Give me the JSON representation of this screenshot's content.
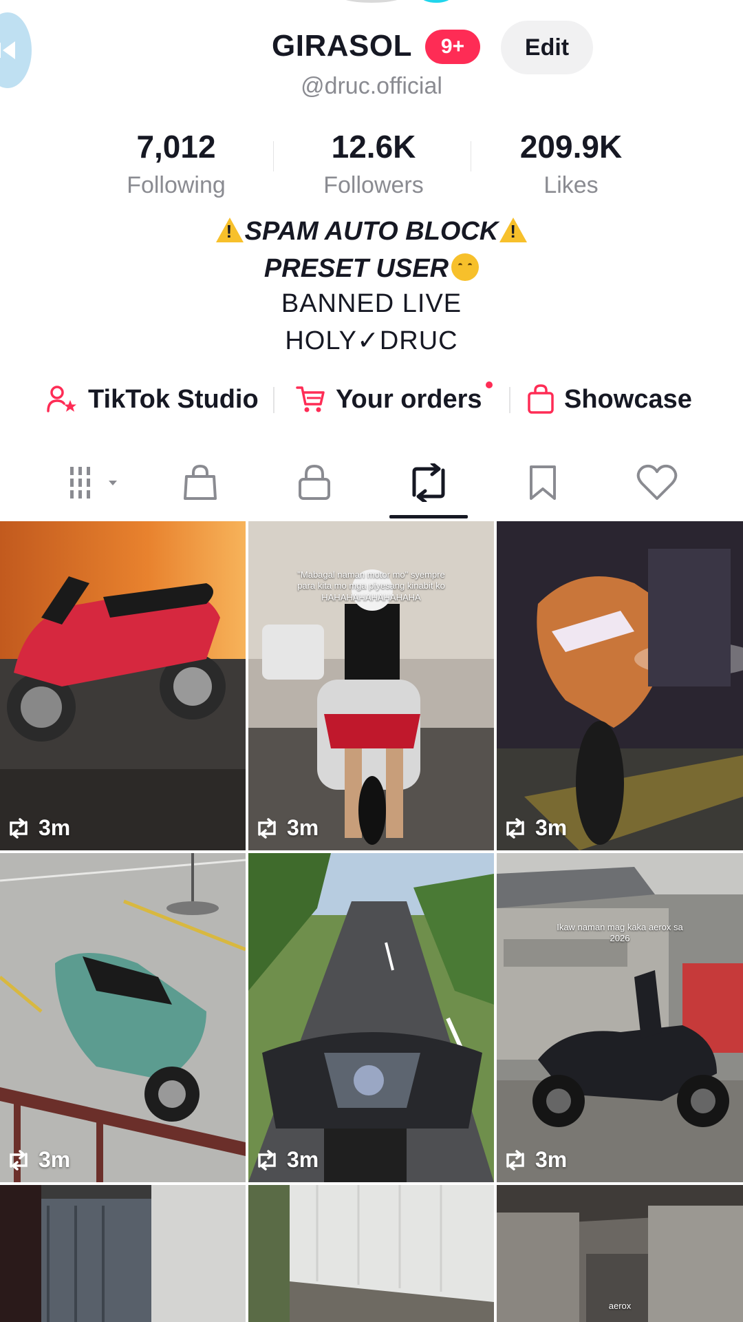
{
  "profile": {
    "name": "GIRASOL",
    "notification_badge": "9+",
    "edit_label": "Edit",
    "handle": "@druc.official"
  },
  "stats": [
    {
      "value": "7,012",
      "label": "Following"
    },
    {
      "value": "12.6K",
      "label": "Followers"
    },
    {
      "value": "209.9K",
      "label": "Likes"
    }
  ],
  "bio": {
    "line1": "SPAM AUTO BLOCK",
    "line2": "PRESET USER",
    "line3": "BANNED LIVE",
    "line4": "HOLY✓DRUC"
  },
  "links": [
    {
      "label": "TikTok Studio",
      "icon": "person-star-icon"
    },
    {
      "label": "Your orders",
      "icon": "cart-icon",
      "has_dot": true
    },
    {
      "label": "Showcase",
      "icon": "shopping-bag-icon"
    }
  ],
  "tabs": [
    {
      "name": "videos-grid",
      "icon": "grid-dropdown-icon"
    },
    {
      "name": "shop",
      "icon": "bag-icon"
    },
    {
      "name": "private",
      "icon": "lock-icon"
    },
    {
      "name": "reposts",
      "icon": "repost-icon",
      "active": true
    },
    {
      "name": "favorites",
      "icon": "bookmark-icon"
    },
    {
      "name": "liked",
      "icon": "heart-icon"
    }
  ],
  "grid": [
    {
      "label": "3m",
      "caption": ""
    },
    {
      "label": "3m",
      "caption": "\"Mabagal naman motor mo\" syempre para kita mo mga piyesang kinabit ko HAHAHAHAHAHAHAHA"
    },
    {
      "label": "3m",
      "caption": ""
    },
    {
      "label": "3m",
      "caption": ""
    },
    {
      "label": "3m",
      "caption": ""
    },
    {
      "label": "3m",
      "caption": "Ikaw naman mag kaka aerox sa 2026"
    },
    {
      "label": "",
      "caption": ""
    },
    {
      "label": "",
      "caption": ""
    },
    {
      "label": "",
      "caption": "aerox"
    }
  ],
  "colors": {
    "accent": "#fe2c55",
    "text": "#161823",
    "muted": "#8a8b91"
  }
}
